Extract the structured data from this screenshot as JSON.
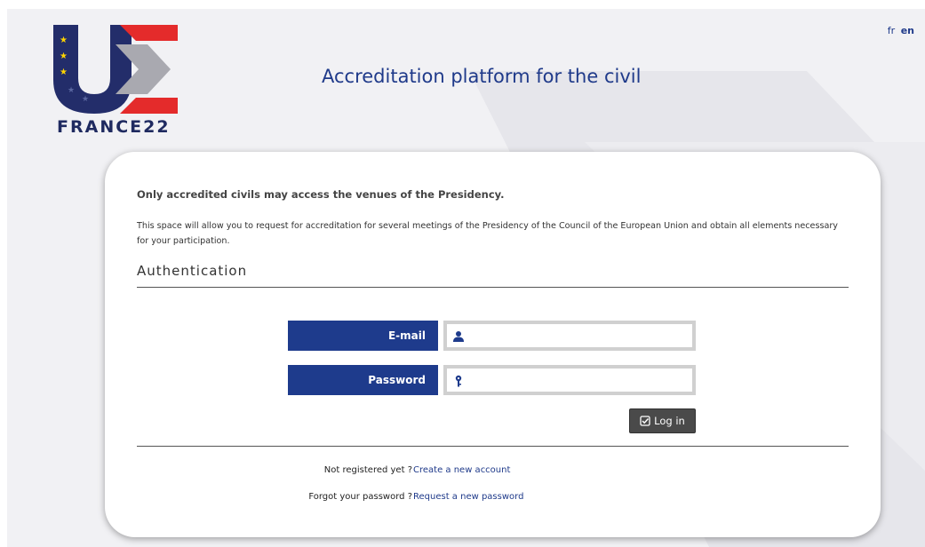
{
  "header": {
    "logo_text": "FRANCE22",
    "title": "Accreditation platform for the civil"
  },
  "language": {
    "options": [
      "fr",
      "en"
    ],
    "active": "en"
  },
  "intro": {
    "title": "Only accredited civils may access the venues of the Presidency.",
    "text": "This space will allow you to request for accreditation for several meetings of the Presidency of the Council of the European Union and obtain all elements necessary for your participation."
  },
  "auth": {
    "title": "Authentication",
    "email_label": "E-mail",
    "email_value": "",
    "password_label": "Password",
    "password_value": "",
    "login_label": "Log in"
  },
  "footer": {
    "register_question": "Not registered yet ?",
    "register_link": "Create a new account",
    "forgot_question": "Forgot your password ?",
    "forgot_link": "Request a new password"
  },
  "colors": {
    "brand_blue": "#1e3b8c",
    "brand_red": "#e42b2b",
    "logo_navy": "#232d6a",
    "button_dark": "#4a4a4a",
    "background": "#f1f1f4"
  },
  "icons": {
    "email": "user-icon",
    "password": "key-icon",
    "login": "check-square-icon"
  }
}
